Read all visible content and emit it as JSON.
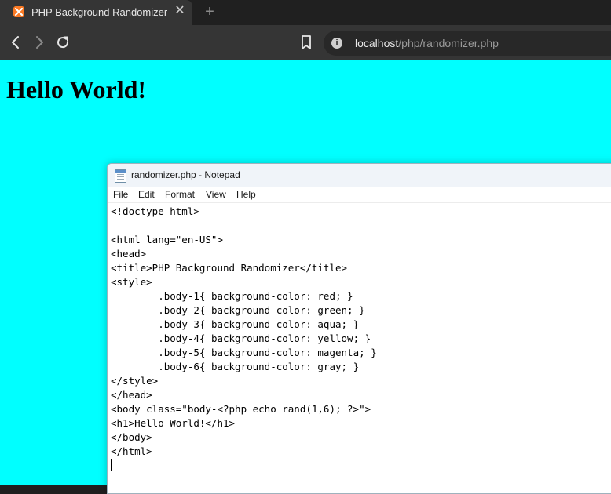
{
  "browser": {
    "tab": {
      "title": "PHP Background Randomizer",
      "favicon": "xampp-icon",
      "close_glyph": "✕"
    },
    "new_tab_glyph": "+",
    "toolbar": {
      "back": "back-arrow-icon",
      "forward": "forward-arrow-icon",
      "reload": "reload-icon",
      "bookmark": "bookmark-icon"
    },
    "address": {
      "info_glyph": "i",
      "host": "localhost",
      "path": "/php/randomizer.php"
    }
  },
  "page": {
    "background_color": "#00ffff",
    "heading": "Hello World!"
  },
  "notepad": {
    "title": "randomizer.php - Notepad",
    "menu": {
      "file": "File",
      "edit": "Edit",
      "format": "Format",
      "view": "View",
      "help": "Help"
    },
    "content": "<!doctype html>\n\n<html lang=\"en-US\">\n<head>\n<title>PHP Background Randomizer</title>\n<style>\n\t.body-1{ background-color: red; }\n\t.body-2{ background-color: green; }\n\t.body-3{ background-color: aqua; }\n\t.body-4{ background-color: yellow; }\n\t.body-5{ background-color: magenta; }\n\t.body-6{ background-color: gray; }\n</style>\n</head>\n<body class=\"body-<?php echo rand(1,6); ?>\">\n<h1>Hello World!</h1>\n</body>\n</html>"
  }
}
